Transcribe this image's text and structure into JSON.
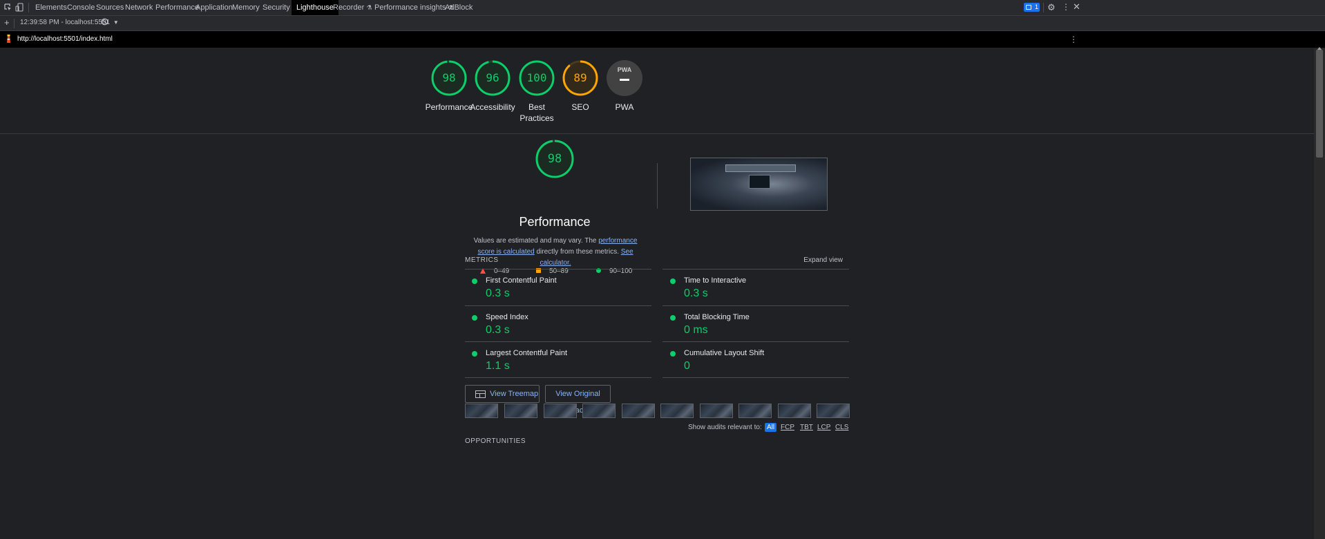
{
  "devtools": {
    "tabs": [
      "Elements",
      "Console",
      "Sources",
      "Network",
      "Performance",
      "Application",
      "Memory",
      "Security",
      "Lighthouse",
      "Recorder",
      "Performance insights",
      "AdBlock"
    ],
    "active_tab": "Lighthouse",
    "issues_count": "1"
  },
  "lighthouse_toolbar": {
    "report_select": "12:39:58 PM - localhost:5501"
  },
  "url_bar": {
    "url": "http://localhost:5501/index.html"
  },
  "summary_gauges": [
    {
      "score": "98",
      "label": "Performance",
      "color": "#0cce6b"
    },
    {
      "score": "96",
      "label": "Accessibility",
      "color": "#0cce6b"
    },
    {
      "score": "100",
      "label": "Best Practices",
      "color": "#0cce6b"
    },
    {
      "score": "89",
      "label": "SEO",
      "color": "#ffa400"
    },
    {
      "score": "PWA",
      "label": "PWA",
      "color": "#9aa0a6"
    }
  ],
  "performance": {
    "score": "98",
    "title": "Performance",
    "desc_prefix": "Values are estimated and may vary. The ",
    "desc_link1": "performance score is calculated",
    "desc_middle": " directly from these metrics. ",
    "desc_link2": "See calculator.",
    "legend": [
      {
        "range": "0–49",
        "shape": "triangle",
        "color": "#ff4e42"
      },
      {
        "range": "50–89",
        "shape": "square",
        "color": "#ffa400"
      },
      {
        "range": "90–100",
        "shape": "circle",
        "color": "#0cce6b"
      }
    ]
  },
  "metrics": {
    "heading": "METRICS",
    "expand_label": "Expand view",
    "items": [
      {
        "name": "First Contentful Paint",
        "value": "0.3 s"
      },
      {
        "name": "Time to Interactive",
        "value": "0.3 s"
      },
      {
        "name": "Speed Index",
        "value": "0.3 s"
      },
      {
        "name": "Total Blocking Time",
        "value": "0 ms"
      },
      {
        "name": "Largest Contentful Paint",
        "value": "1.1 s"
      },
      {
        "name": "Cumulative Layout Shift",
        "value": "0"
      }
    ]
  },
  "buttons": {
    "treemap": "View Treemap",
    "trace": "View Original Trace"
  },
  "audit_filter": {
    "label": "Show audits relevant to:",
    "options": [
      "All",
      "FCP",
      "TBT",
      "LCP",
      "CLS"
    ],
    "active": "All"
  },
  "next_section": "OPPORTUNITIES"
}
